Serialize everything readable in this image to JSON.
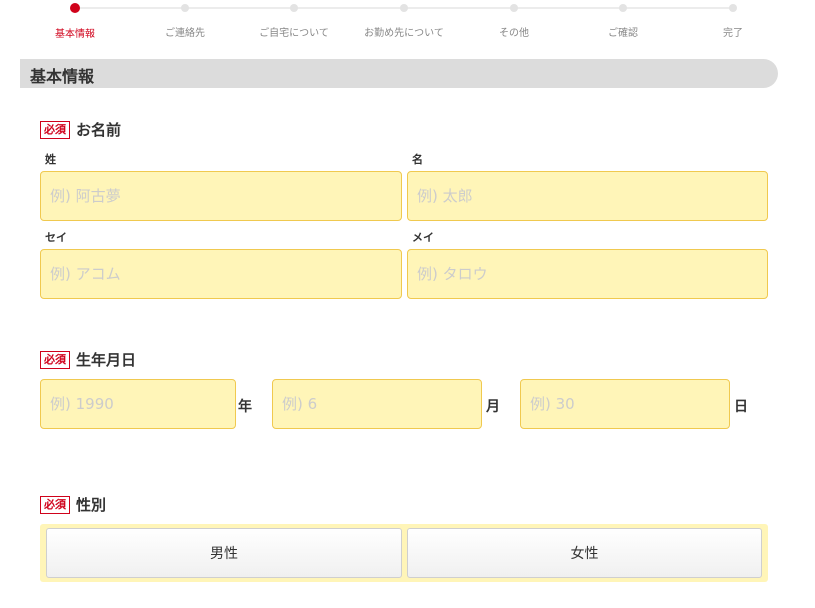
{
  "progress": {
    "steps": [
      {
        "label": "基本情報",
        "active": true
      },
      {
        "label": "ご連絡先",
        "active": false
      },
      {
        "label": "ご自宅について",
        "active": false
      },
      {
        "label": "お勤め先について",
        "active": false
      },
      {
        "label": "その他",
        "active": false
      },
      {
        "label": "ご確認",
        "active": false
      },
      {
        "label": "完了",
        "active": false
      }
    ]
  },
  "section": {
    "title": "基本情報"
  },
  "required_badge": "必須",
  "name": {
    "label": "お名前",
    "last_label": "姓",
    "first_label": "名",
    "last_placeholder": "例) 阿古夢",
    "first_placeholder": "例) 太郎",
    "last_kana_label": "セイ",
    "first_kana_label": "メイ",
    "last_kana_placeholder": "例) アコム",
    "first_kana_placeholder": "例) タロウ"
  },
  "birthday": {
    "label": "生年月日",
    "year_placeholder": "例) 1990",
    "year_unit": "年",
    "month_placeholder": "例) 6",
    "month_unit": "月",
    "day_placeholder": "例) 30",
    "day_unit": "日"
  },
  "gender": {
    "label": "性別",
    "male": "男性",
    "female": "女性"
  },
  "colors": {
    "accent": "#d0021b",
    "input_bg": "#fff5b8",
    "input_border": "#f0c94f"
  }
}
